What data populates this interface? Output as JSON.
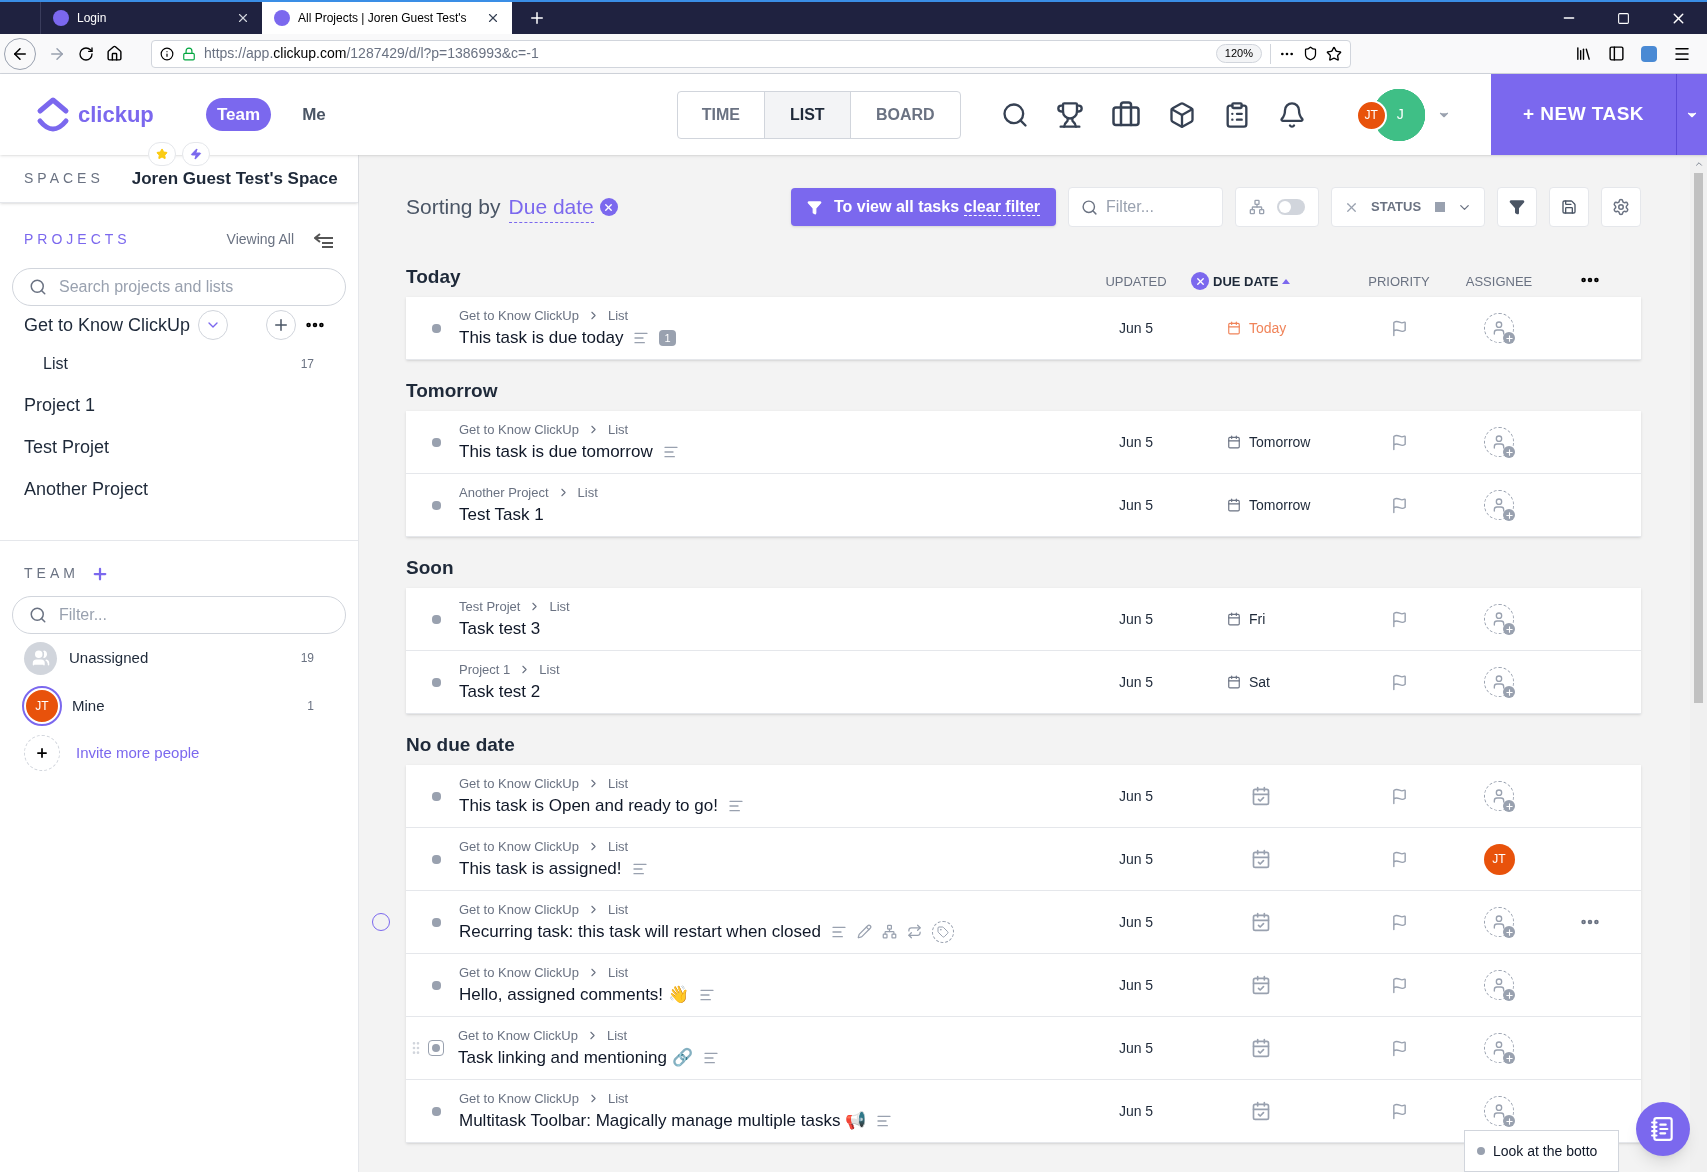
{
  "browser": {
    "tabs": [
      {
        "title": "Login",
        "selected": false
      },
      {
        "title": "All Projects | Joren Guest Test's",
        "selected": true
      }
    ],
    "url_prefix": "https://app.",
    "url_domain": "clickup.com",
    "url_path": "/1287429/d/l?p=1386993&c=-1",
    "zoom": "120%"
  },
  "header": {
    "logo": "clickup",
    "scopes": [
      {
        "label": "Team",
        "selected": true
      },
      {
        "label": "Me",
        "selected": false
      }
    ],
    "views": [
      {
        "label": "TIME",
        "selected": false
      },
      {
        "label": "LIST",
        "selected": true
      },
      {
        "label": "BOARD",
        "selected": false
      }
    ],
    "avatar_front": "JT",
    "avatar_back": "J",
    "new_task": "+ NEW TASK"
  },
  "sidebar": {
    "spaces_label": "SPACES",
    "space_name": "Joren Guest Test's Space",
    "projects_label": "PROJECTS",
    "viewing": "Viewing All",
    "search_placeholder": "Search projects and lists",
    "projects": [
      {
        "name": "Get to Know ClickUp",
        "expanded": true,
        "children": [
          {
            "name": "List",
            "count": "17"
          }
        ]
      },
      {
        "name": "Project 1",
        "expanded": false
      },
      {
        "name": "Test Projet",
        "expanded": false
      },
      {
        "name": "Another Project",
        "expanded": false
      }
    ],
    "team_label": "TEAM",
    "filter_placeholder": "Filter...",
    "members": [
      {
        "kind": "group",
        "name": "Unassigned",
        "count": "19"
      },
      {
        "kind": "person",
        "initials": "JT",
        "name": "Mine",
        "count": "1"
      }
    ],
    "invite": "Invite more people"
  },
  "main": {
    "sorting_prefix": "Sorting by",
    "sort_field": "Due date",
    "filter_notice": "To view all tasks",
    "filter_link": "clear filter",
    "filter_placeholder": "Filter...",
    "subtasks_on": false,
    "status": "STATUS",
    "columns": {
      "updated": "UPDATED",
      "due": "DUE DATE",
      "priority": "PRIORITY",
      "assignee": "ASSIGNEE"
    },
    "groups": [
      {
        "title": "Today",
        "tasks": [
          {
            "project": "Get to Know ClickUp",
            "list": "List",
            "name": "This task is due today",
            "has_description": true,
            "comments": "1",
            "updated": "Jun 5",
            "kind": "due_today",
            "due": "Today",
            "hovered": false,
            "handle": false
          }
        ]
      },
      {
        "title": "Tomorrow",
        "tasks": [
          {
            "project": "Get to Know ClickUp",
            "list": "List",
            "name": "This task is due tomorrow",
            "has_description": true,
            "updated": "Jun 5",
            "kind": "due_date",
            "due": "Tomorrow",
            "hovered": false,
            "handle": false
          },
          {
            "project": "Another Project",
            "list": "List",
            "name": "Test Task 1",
            "has_description": false,
            "updated": "Jun 5",
            "kind": "due_date",
            "due": "Tomorrow",
            "hovered": false,
            "handle": false
          }
        ]
      },
      {
        "title": "Soon",
        "tasks": [
          {
            "project": "Test Projet",
            "list": "List",
            "name": "Task test 3",
            "has_description": false,
            "updated": "Jun 5",
            "kind": "due_date",
            "due": "Fri",
            "hovered": false,
            "handle": false
          },
          {
            "project": "Project 1",
            "list": "List",
            "name": "Task test 2",
            "has_description": false,
            "updated": "Jun 5",
            "kind": "due_date",
            "due": "Sat",
            "hovered": false,
            "handle": false
          }
        ]
      },
      {
        "title": "No due date",
        "tasks": [
          {
            "project": "Get to Know ClickUp",
            "list": "List",
            "name": "This task is Open and ready to go!",
            "has_description": true,
            "updated": "Jun 5",
            "kind": "no_due",
            "hovered": false,
            "handle": false
          },
          {
            "project": "Get to Know ClickUp",
            "list": "List",
            "name": "This task is assigned!",
            "has_description": true,
            "updated": "Jun 5",
            "kind": "no_due",
            "assignee": "JT",
            "hovered": false,
            "handle": false
          },
          {
            "project": "Get to Know ClickUp",
            "list": "List",
            "name": "Recurring task: this task will restart when closed",
            "has_description": true,
            "updated": "Jun 5",
            "kind": "no_due",
            "hovered": true,
            "handle": false
          },
          {
            "project": "Get to Know ClickUp",
            "list": "List",
            "name": "Hello, assigned comments! 👋",
            "has_description": true,
            "updated": "Jun 5",
            "kind": "no_due",
            "hovered": false,
            "handle": false
          },
          {
            "project": "Get to Know ClickUp",
            "list": "List",
            "name": "Task linking and mentioning 🔗",
            "has_description": true,
            "updated": "Jun 5",
            "kind": "no_due",
            "hovered": false,
            "handle": true
          },
          {
            "project": "Get to Know ClickUp",
            "list": "List",
            "name": "Multitask Toolbar: Magically manage multiple tasks 📢",
            "has_description": true,
            "updated": "Jun 5",
            "kind": "no_due",
            "hovered": false,
            "handle": false
          }
        ]
      }
    ],
    "popup": "Look at the botto"
  }
}
